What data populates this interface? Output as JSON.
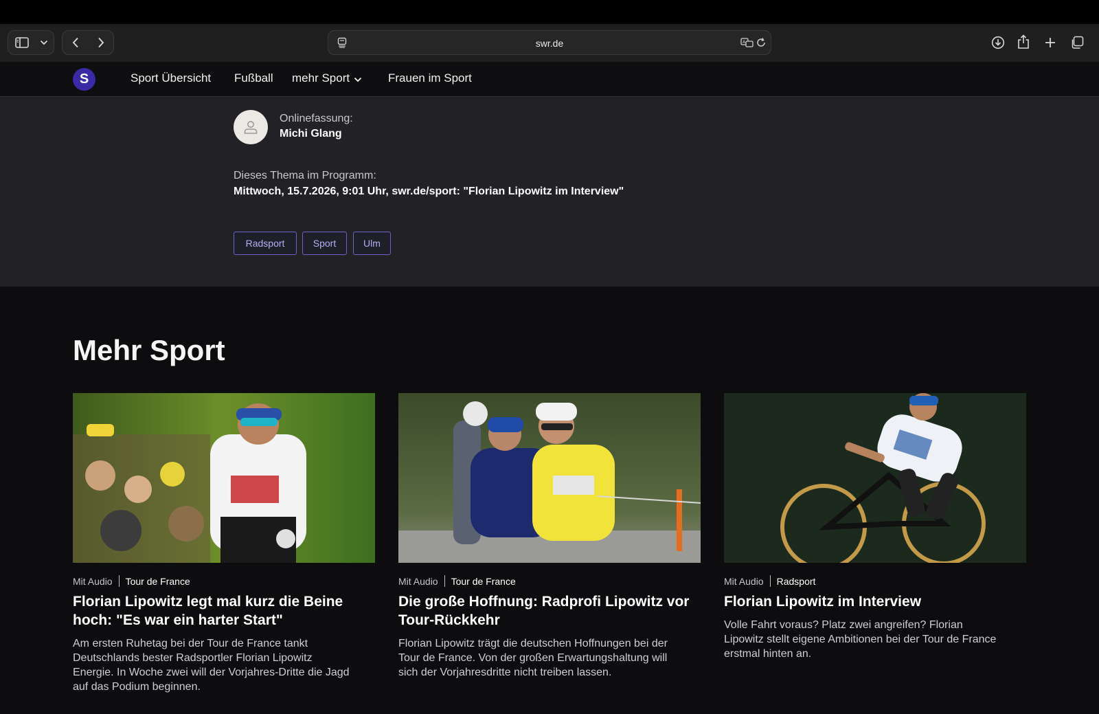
{
  "browser": {
    "url": "swr.de"
  },
  "nav": {
    "items": [
      {
        "label": "Sport Übersicht"
      },
      {
        "label": "Fußball"
      },
      {
        "label": "mehr Sport"
      },
      {
        "label": "Frauen im Sport"
      }
    ],
    "logo_letter": "S"
  },
  "author": {
    "label": "Onlinefassung:",
    "name": "Michi Glang"
  },
  "program": {
    "label": "Dieses Thema im Programm:",
    "value": "Mittwoch, 15.7.2026, 9:01 Uhr, swr.de/sport: \"Florian Lipowitz im Interview\""
  },
  "tags": [
    "Radsport",
    "Sport",
    "Ulm"
  ],
  "more": {
    "title": "Mehr Sport",
    "cards": [
      {
        "meta": "Mit Audio",
        "category": "Tour de France",
        "title": "Florian Lipowitz legt mal kurz die Beine hoch: \"Es war ein harter Start\"",
        "text": "Am ersten Ruhetag bei der Tour de France tankt Deutschlands bester Radsportler Florian Lipowitz Energie. In Woche zwei will der Vorjahres-Dritte die Jagd auf das Podium beginnen."
      },
      {
        "meta": "Mit Audio",
        "category": "Tour de France",
        "title": "Die große Hoffnung: Radprofi Lipowitz vor Tour-Rückkehr",
        "text": "Florian Lipowitz trägt die deutschen Hoffnungen bei der Tour de France. Von der großen Erwartungshaltung will sich der Vorjahresdritte nicht treiben lassen."
      },
      {
        "meta": "Mit Audio",
        "category": "Radsport",
        "title": "Florian Lipowitz im Interview",
        "text": "Volle Fahrt voraus? Platz zwei angreifen? Florian Lipowitz stellt eigene Ambitionen bei der Tour de France erstmal hinten an."
      }
    ]
  },
  "colors": {
    "accent": "#3a2aa6",
    "tag_border": "#6e63c9"
  }
}
